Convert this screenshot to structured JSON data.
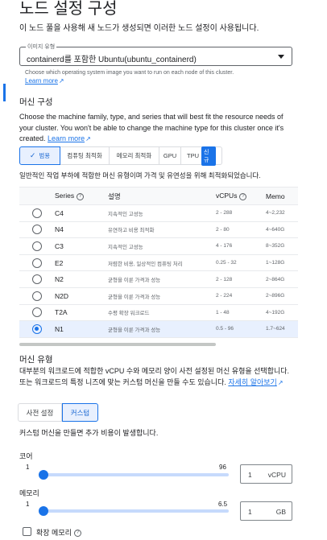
{
  "page": {
    "title": "노드 설정 구성",
    "intro": "이 노드 풀을 사용해 새 노드가 생성되면 이러한 노드 설정이 사용됩니다."
  },
  "image_type": {
    "label": "이미지 유형",
    "value": "containerd를 포함한 Ubuntu(ubuntu_containerd)",
    "hint": "Choose which operating system image you want to run on each node of this cluster.",
    "learn_more": "Learn more"
  },
  "machine_config": {
    "title": "머신 구성",
    "desc": "Choose the machine family, type, and series that will best fit the resource needs of your cluster. You won't be able to change the machine type for this cluster once it's created.",
    "learn_more": "Learn more",
    "families": [
      {
        "label": "범용",
        "selected": true
      },
      {
        "label": "컴퓨팅 최적화",
        "selected": false
      },
      {
        "label": "메모리 최적화",
        "selected": false
      },
      {
        "label": "GPU",
        "selected": false
      },
      {
        "label": "TPU",
        "selected": false,
        "badge": "신규"
      }
    ],
    "family_desc": "일반적인 작업 부하에 적합한 머신 유형이며 가격 및 유연성을 위해 최적화되었습니다."
  },
  "series_table": {
    "columns": [
      "Series",
      "설명",
      "vCPUs",
      "Memo"
    ],
    "rows": [
      {
        "series": "C4",
        "desc": "지속적인 고성능",
        "vcpus": "2 - 288",
        "memory": "4~2,232",
        "selected": false
      },
      {
        "series": "N4",
        "desc": "유연하고 비용 최적화",
        "vcpus": "2 - 80",
        "memory": "4~640G",
        "selected": false
      },
      {
        "series": "C3",
        "desc": "지속적인 고성능",
        "vcpus": "4 - 176",
        "memory": "8~352G",
        "selected": false
      },
      {
        "series": "E2",
        "desc": "저렴한 비용, 일상적인 컴퓨팅 처리",
        "vcpus": "0.25 - 32",
        "memory": "1~128G",
        "selected": false
      },
      {
        "series": "N2",
        "desc": "균형을 이룬 가격과 성능",
        "vcpus": "2 - 128",
        "memory": "2~864G",
        "selected": false
      },
      {
        "series": "N2D",
        "desc": "균형을 이룬 가격과 성능",
        "vcpus": "2 - 224",
        "memory": "2~896G",
        "selected": false
      },
      {
        "series": "T2A",
        "desc": "수평 확장 워크로드",
        "vcpus": "1 - 48",
        "memory": "4~192G",
        "selected": false
      },
      {
        "series": "N1",
        "desc": "균형을 이룬 가격과 성능",
        "vcpus": "0.5 - 96",
        "memory": "1.7~624",
        "selected": true
      }
    ]
  },
  "machine_type": {
    "title": "머신 유형",
    "desc": "대부분의 워크로드에 적합한 vCPU 수와 메모리 양이 사전 설정된 머신 유형을 선택합니다. 또는 워크로드의 특정 니즈에 맞는 커스텀 머신을 만들 수도 있습니다.",
    "learn_more": "자세히 알아보기",
    "preset_label": "사전 설정",
    "custom_label": "커스텀",
    "custom_note": "커스텀 머신을 만들면 추가 비용이 발생합니다."
  },
  "cores": {
    "label": "코어",
    "min": "1",
    "max": "96",
    "value": "1",
    "unit": "vCPU",
    "level": 0
  },
  "memory": {
    "label": "메모리",
    "min": "1",
    "max": "6.5",
    "value": "1",
    "unit": "GB",
    "level": 0
  },
  "extended_memory": {
    "label": "확장 메모리",
    "checked": false
  },
  "colors": {
    "accent": "#1a73e8",
    "selected_bg": "#e8f0fe",
    "track": "#c6dafc"
  }
}
